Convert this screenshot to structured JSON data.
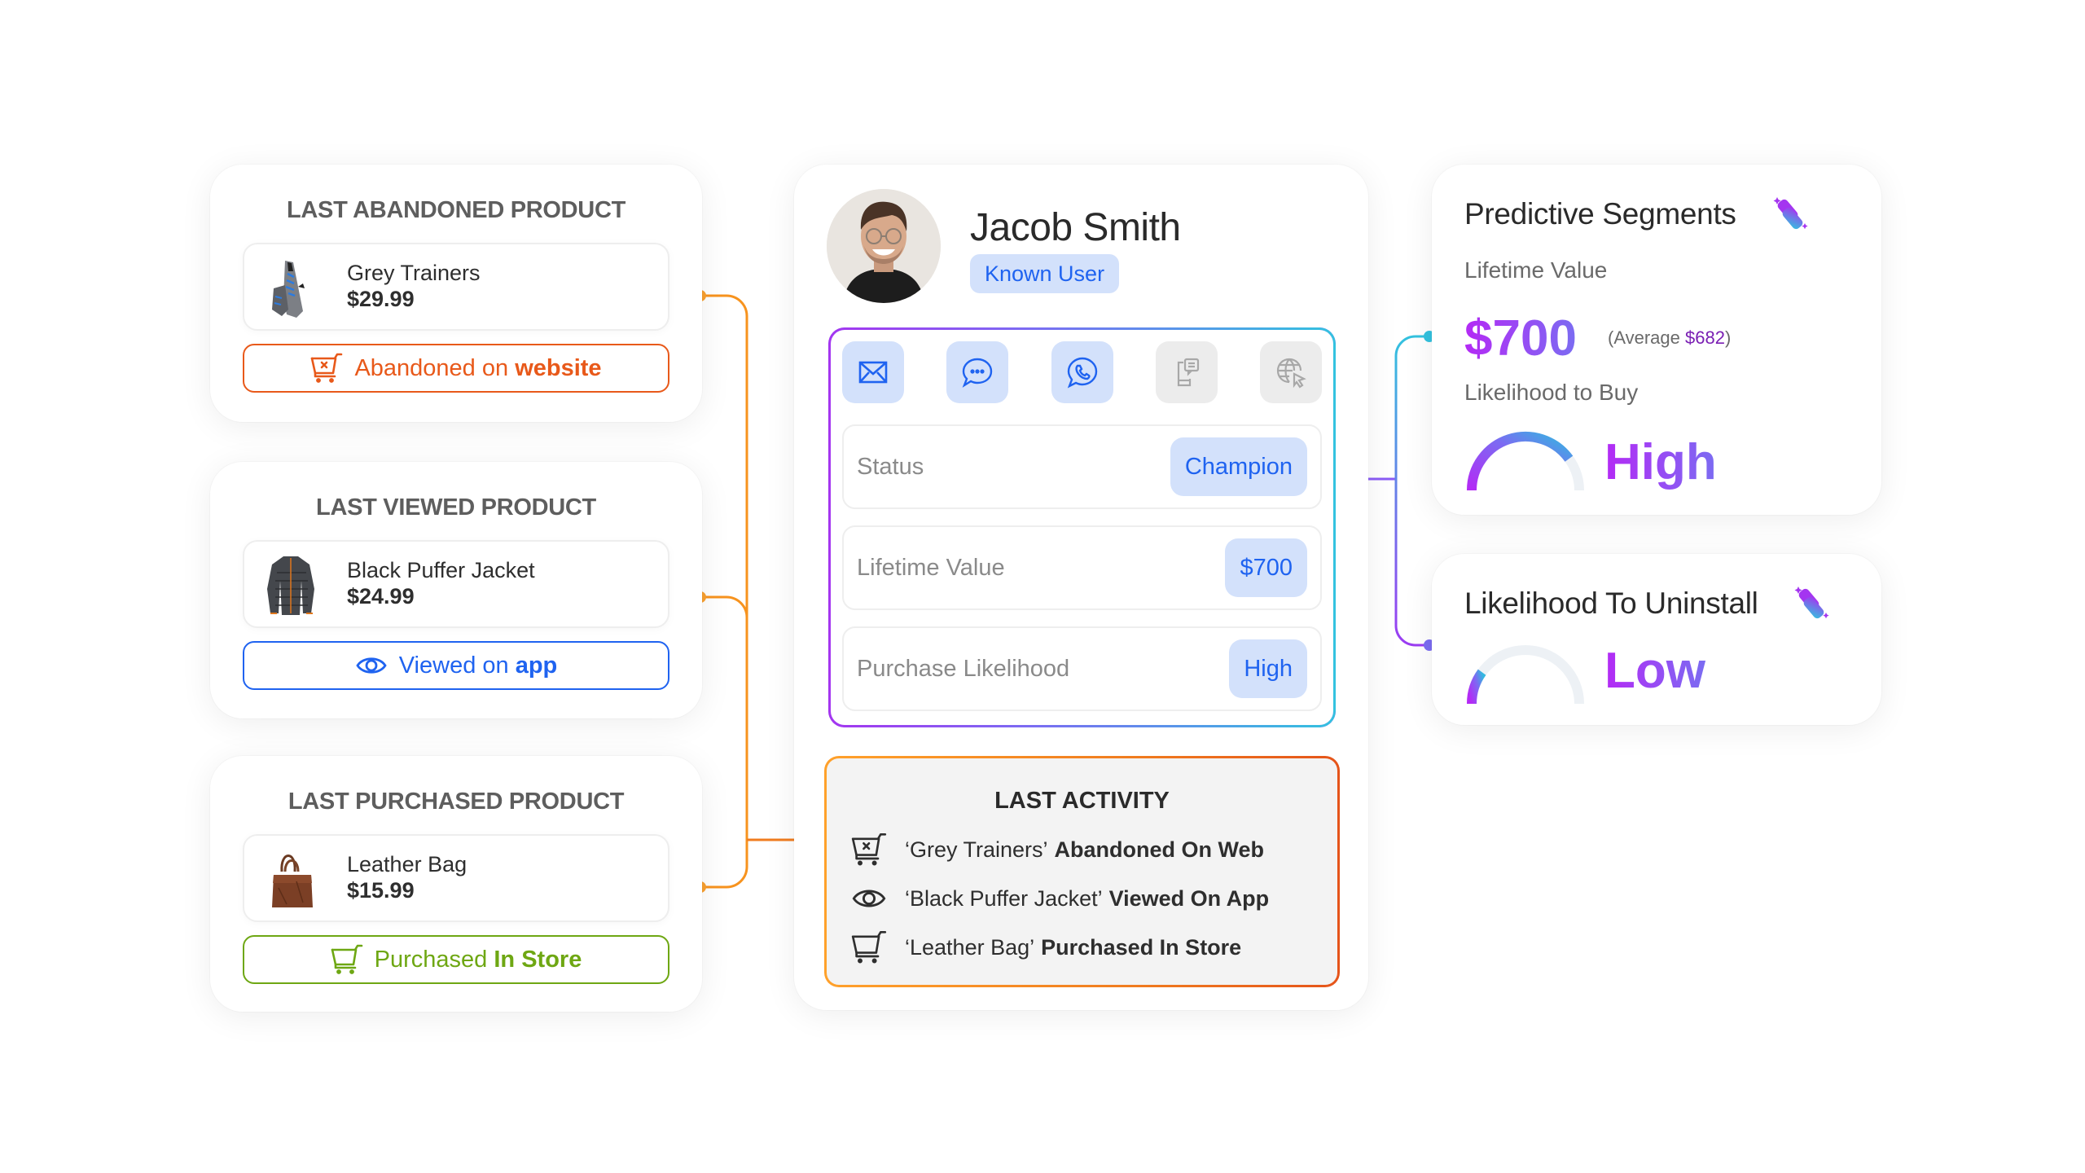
{
  "colors": {
    "orange": "#e8591a",
    "blue": "#1f63f0",
    "green": "#6ea713",
    "connector_orange": "#f7931e",
    "purple": "#a435f0",
    "cyan": "#33c2df",
    "badge_bg": "#d3e1fb"
  },
  "products": [
    {
      "title": "LAST ABANDONED PRODUCT",
      "name": "Grey Trainers",
      "price": "$29.99",
      "image": "sneaker-image",
      "status_prefix": "Abandoned on",
      "status_bold": "website",
      "status_icon": "cart-abandoned-icon",
      "status_color": "orange"
    },
    {
      "title": "LAST VIEWED PRODUCT",
      "name": "Black Puffer Jacket",
      "price": "$24.99",
      "image": "jacket-image",
      "status_prefix": "Viewed on",
      "status_bold": "app",
      "status_icon": "eye-icon",
      "status_color": "blue"
    },
    {
      "title": "LAST PURCHASED PRODUCT",
      "name": "Leather Bag",
      "price": "$15.99",
      "image": "bag-image",
      "status_prefix": "Purchased",
      "status_bold": "In Store",
      "status_icon": "cart-icon",
      "status_color": "green"
    }
  ],
  "profile": {
    "name": "Jacob Smith",
    "badge": "Known User",
    "channels": [
      {
        "icon": "email-icon",
        "active": true
      },
      {
        "icon": "chat-bubble-icon",
        "active": true
      },
      {
        "icon": "whatsapp-icon",
        "active": true
      },
      {
        "icon": "sms-phone-icon",
        "active": false
      },
      {
        "icon": "web-push-globe-icon",
        "active": false
      }
    ],
    "attributes": [
      {
        "label": "Status",
        "value": "Champion"
      },
      {
        "label": "Lifetime Value",
        "value": "$700"
      },
      {
        "label": "Purchase Likelihood",
        "value": "High"
      }
    ],
    "activity": {
      "title": "LAST ACTIVITY",
      "items": [
        {
          "icon": "cart-abandoned-icon",
          "product": "‘Grey Trainers’",
          "action": "Abandoned On Web"
        },
        {
          "icon": "eye-icon",
          "product": "‘Black Puffer Jacket’",
          "action": "Viewed On App"
        },
        {
          "icon": "cart-icon",
          "product": "‘Leather Bag’",
          "action": "Purchased In Store"
        }
      ]
    }
  },
  "predictive": {
    "title": "Predictive Segments",
    "ltv_label": "Lifetime Value",
    "ltv_value": "$700",
    "avg_prefix": "(Average ",
    "avg_value": "$682",
    "avg_suffix": ")",
    "buy_label": "Likelihood to Buy",
    "buy_value": "High",
    "buy_gauge_fraction": 0.8
  },
  "uninstall": {
    "title": "Likelihood To Uninstall",
    "value": "Low",
    "gauge_fraction": 0.2
  }
}
